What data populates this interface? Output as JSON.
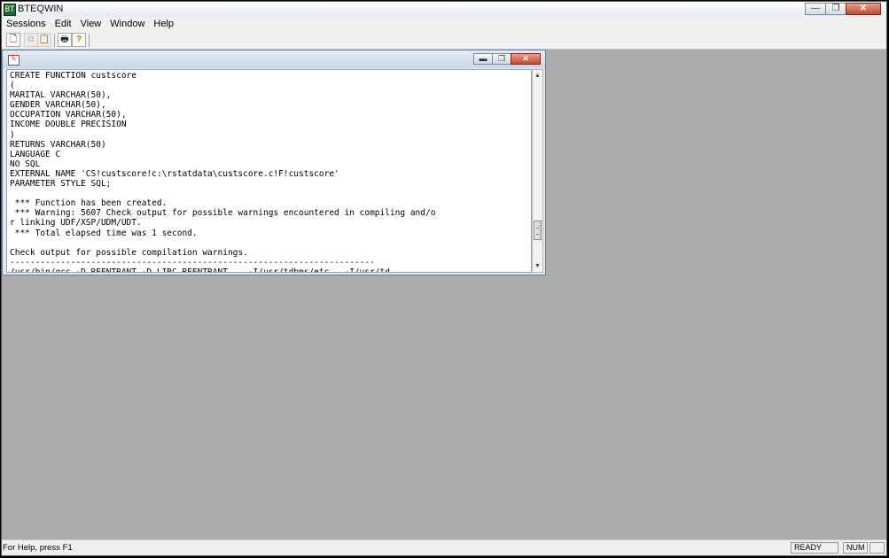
{
  "app": {
    "title": "BTEQWIN",
    "icon": "BT",
    "window_buttons": [
      "—",
      "❐",
      "✕"
    ]
  },
  "menu": [
    "Sessions",
    "Edit",
    "View",
    "Window",
    "Help"
  ],
  "toolbar": {
    "icons": [
      {
        "name": "new-document-icon",
        "glyph": "🗋",
        "enabled": true
      },
      {
        "name": "copy-icon",
        "glyph": "⧉",
        "enabled": false
      },
      {
        "name": "paste-icon",
        "glyph": "📋",
        "enabled": false
      },
      {
        "name": "print-icon",
        "glyph": "🖶",
        "enabled": true
      },
      {
        "name": "help-icon",
        "glyph": "?",
        "enabled": true
      }
    ]
  },
  "child_window": {
    "icon": "✎",
    "buttons": [
      "▬",
      "❐",
      "✕"
    ],
    "lines": [
      "CREATE FUNCTION custscore",
      "(",
      "MARITAL VARCHAR(50),",
      "GENDER VARCHAR(50),",
      "OCCUPATION VARCHAR(50),",
      "INCOME DOUBLE PRECISION",
      ")",
      "RETURNS VARCHAR(50)",
      "LANGUAGE C",
      "NO SQL",
      "EXTERNAL NAME 'CS!custscore!c:\\rstatdata\\custscore.c!F!custscore'",
      "PARAMETER STYLE SQL;",
      "",
      " *** Function has been created.",
      " *** Warning: 5607 Check output for possible warnings encountered in compiling and/o",
      "r linking UDF/XSP/UDM/UDT.",
      " *** Total elapsed time was 1 second.",
      "",
      "Check output for possible compilation warnings.",
      "------------------------------------------------------------------------",
      "/usr/bin/gcc -D_REENTRANT -D_LIBC_REENTRANT    -I/usr/tdbms/etc   -I/usr/td"
    ],
    "scroll": {
      "up": "▲",
      "down": "▼"
    }
  },
  "status": {
    "text": "For Help, press F1",
    "ready": "READY",
    "num": "NUM"
  }
}
